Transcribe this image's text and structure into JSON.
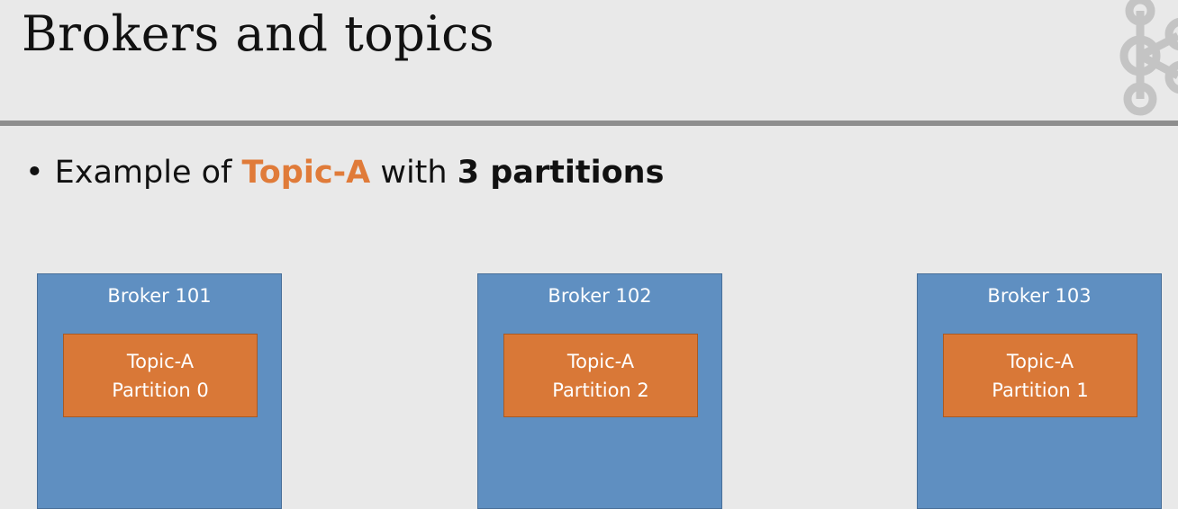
{
  "slide": {
    "title": "Brokers and topics",
    "logo_icon": "kafka-logo-icon",
    "bullet": {
      "symbol": "•",
      "prefix": "Example of ",
      "topic": "Topic-A",
      "middle": " with ",
      "emphasis": "3 partitions"
    }
  },
  "brokers": [
    {
      "label": "Broker 101",
      "partition": {
        "topic": "Topic-A",
        "name": "Partition 0"
      }
    },
    {
      "label": "Broker 102",
      "partition": {
        "topic": "Topic-A",
        "name": "Partition 2"
      }
    },
    {
      "label": "Broker 103",
      "partition": {
        "topic": "Topic-A",
        "name": "Partition 1"
      }
    }
  ],
  "colors": {
    "background": "#e9e9e9",
    "broker": "#5f8fc1",
    "partition": "#d97837",
    "accent_text": "#e07b39",
    "divider": "#8e8e8e"
  }
}
